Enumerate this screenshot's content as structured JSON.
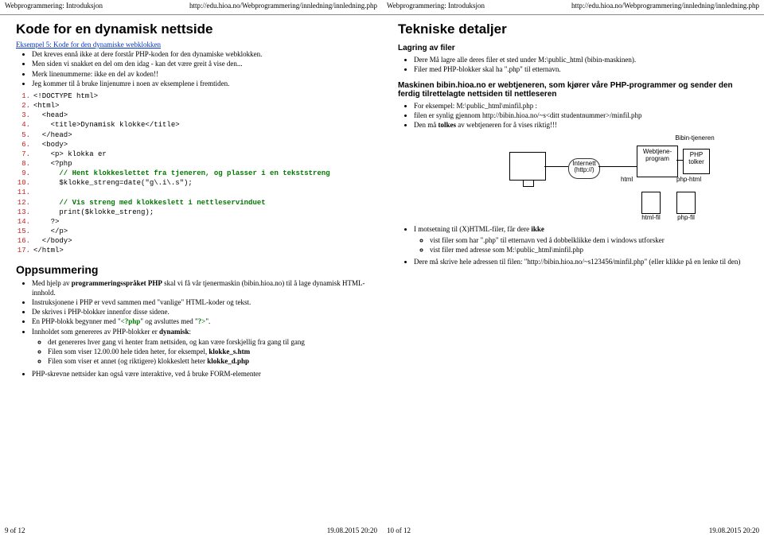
{
  "header": {
    "title_left": "Webprogrammering: Introduksjon",
    "url": "http://edu.hioa.no/Webprogrammering/innledning/innledning.php"
  },
  "left": {
    "h2": "Kode for en dynamisk nettside",
    "ex_link": "Eksempel 5: Kode for den dynamiske webklokken",
    "bullets": [
      "Det kreves ennå ikke at dere forstår PHP-koden for den dynamiske webklokken.",
      "Men siden vi snakket en del om den idag - kan det være greit å vise den...",
      "Merk linenummerne: ikke en del av koden!!",
      "Jeg kommer til å bruke linjenumre i noen av eksemplene i fremtiden."
    ],
    "code": {
      "l1": "<!DOCTYPE html>",
      "l2": "<html>",
      "l3": "  <head>",
      "l4": "    <title>Dynamisk klokke</title>",
      "l5": "  </head>",
      "l6": "  <body>",
      "l7": "    <p> klokka er",
      "l8": "    <?php",
      "l9c": "      // Hent klokkeslettet fra tjeneren, og plasser i en tekststreng",
      "l10": "      $klokke_streng=date(\"g\\.i\\.s\");",
      "l11": "",
      "l12c": "      // Vis streng med klokkeslett i nettleservinduet",
      "l13": "      print($klokke_streng);",
      "l14": "    ?>",
      "l15": "    </p>",
      "l16": "  </body>",
      "l17": "</html>"
    },
    "h3": "Oppsummering",
    "sum": {
      "b1a": "Med hjelp av ",
      "b1b": "programmeringsspråket PHP",
      "b1c": " skal vi få vår tjenermaskin (bibin.hioa.no) til å lage dynamisk HTML-innhold.",
      "b2": "Instruksjonene i PHP er vevd sammen med \"vanlige\" HTML-koder og tekst.",
      "b3": "De skrives i PHP-blokker innenfor disse sidene.",
      "b4a": "En PHP-blokk begynner med \"",
      "b4b": "<?php",
      "b4c": "\" og avsluttes med \"",
      "b4d": "?>",
      "b4e": "\".",
      "b5a": "Innholdet som genereres av PHP-blokker er ",
      "b5b": "dynamisk",
      "b5c": ":",
      "b5s1": "det genereres hver gang vi henter fram nettsiden, og kan være forskjellig fra gang til gang",
      "b5s2a": "Filen som viser 12.00.00 hele tiden heter, for eksempel, ",
      "b5s2b": "klokke_s.htm",
      "b5s3a": "Filen som viser et annet (og riktigere) klokkeslett heter ",
      "b5s3b": "klokke_d.php",
      "b6": "PHP-skrevne nettsider kan også være interaktive, ved å bruke FORM-elementer"
    }
  },
  "right": {
    "h2": "Tekniske detaljer",
    "h4a": "Lagring av filer",
    "lag": {
      "b1": "Dere Må lagre alle deres filer et sted under M:\\public_html (bibin-maskinen).",
      "b2": "Filer med PHP-blokker skal ha \".php\" til etternavn."
    },
    "h4b": "Maskinen bibin.hioa.no er webtjeneren, som kjører våre PHP-programmer og sender den ferdig tilrettelagte nettsiden til nettleseren",
    "mas": {
      "b1": "For eksempel: M:\\public_html\\minfil.php :",
      "b2": "filen er synlig gjennom http://bibin.hioa.no/~s<ditt studentnummer>/minfil.php",
      "b3a": "Den må ",
      "b3b": "tolkes",
      "b3c": " av webtjeneren for å vises riktig!!!"
    },
    "diagram": {
      "bibin": "Bibin-tjeneren",
      "server": "Webtjene-program",
      "php": "PHP tolker",
      "cloud1": "Internett",
      "cloud2": "(http://)",
      "html": "html",
      "phpphtml": "php-html",
      "htmlfil": "html-fil",
      "phpfil": "php-fil"
    },
    "mot": {
      "b1a": "I motsetning til (X)HTML-filer, får dere ",
      "b1b": "ikke",
      "b1s1": "vist filer som har \".php\" til etternavn ved å dobbelklikke dem i windows utforsker",
      "b1s2": "vist filer med adresse som M:\\public_html\\minfil.php",
      "b2": "Dere må skrive hele adressen til filen: \"http://bibin.hioa.no/~s123456/minfil.php\" (eller klikke på en lenke til den)"
    }
  },
  "footer": {
    "left_pg": "9 of 12",
    "right_pg": "10 of 12",
    "ts": "19.08.2015 20:20"
  }
}
